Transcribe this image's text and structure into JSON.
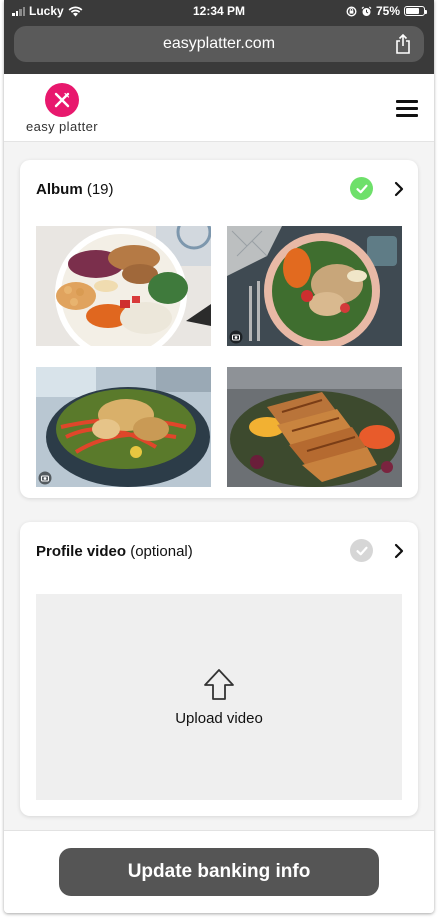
{
  "status_bar": {
    "carrier": "Lucky",
    "time": "12:34 PM",
    "battery": "75%",
    "battery_level": 0.75
  },
  "browser": {
    "url": "easyplatter.com"
  },
  "header": {
    "logo_text": "easy platter",
    "brand_color": "#e8186d"
  },
  "album": {
    "title": "Album",
    "count": "(19)",
    "status": "complete",
    "status_color": "#6ee06a",
    "photos": [
      {
        "name": "grain bowl with grilled chicken"
      },
      {
        "name": "chicken salad plate"
      },
      {
        "name": "chicken noodle salad"
      },
      {
        "name": "sliced grilled chicken"
      }
    ]
  },
  "profile_video": {
    "title": "Profile video",
    "subtitle": "(optional)",
    "status": "incomplete",
    "status_color": "#d6d6d6",
    "upload_label": "Upload video"
  },
  "footer": {
    "cta_label": "Update banking info"
  }
}
